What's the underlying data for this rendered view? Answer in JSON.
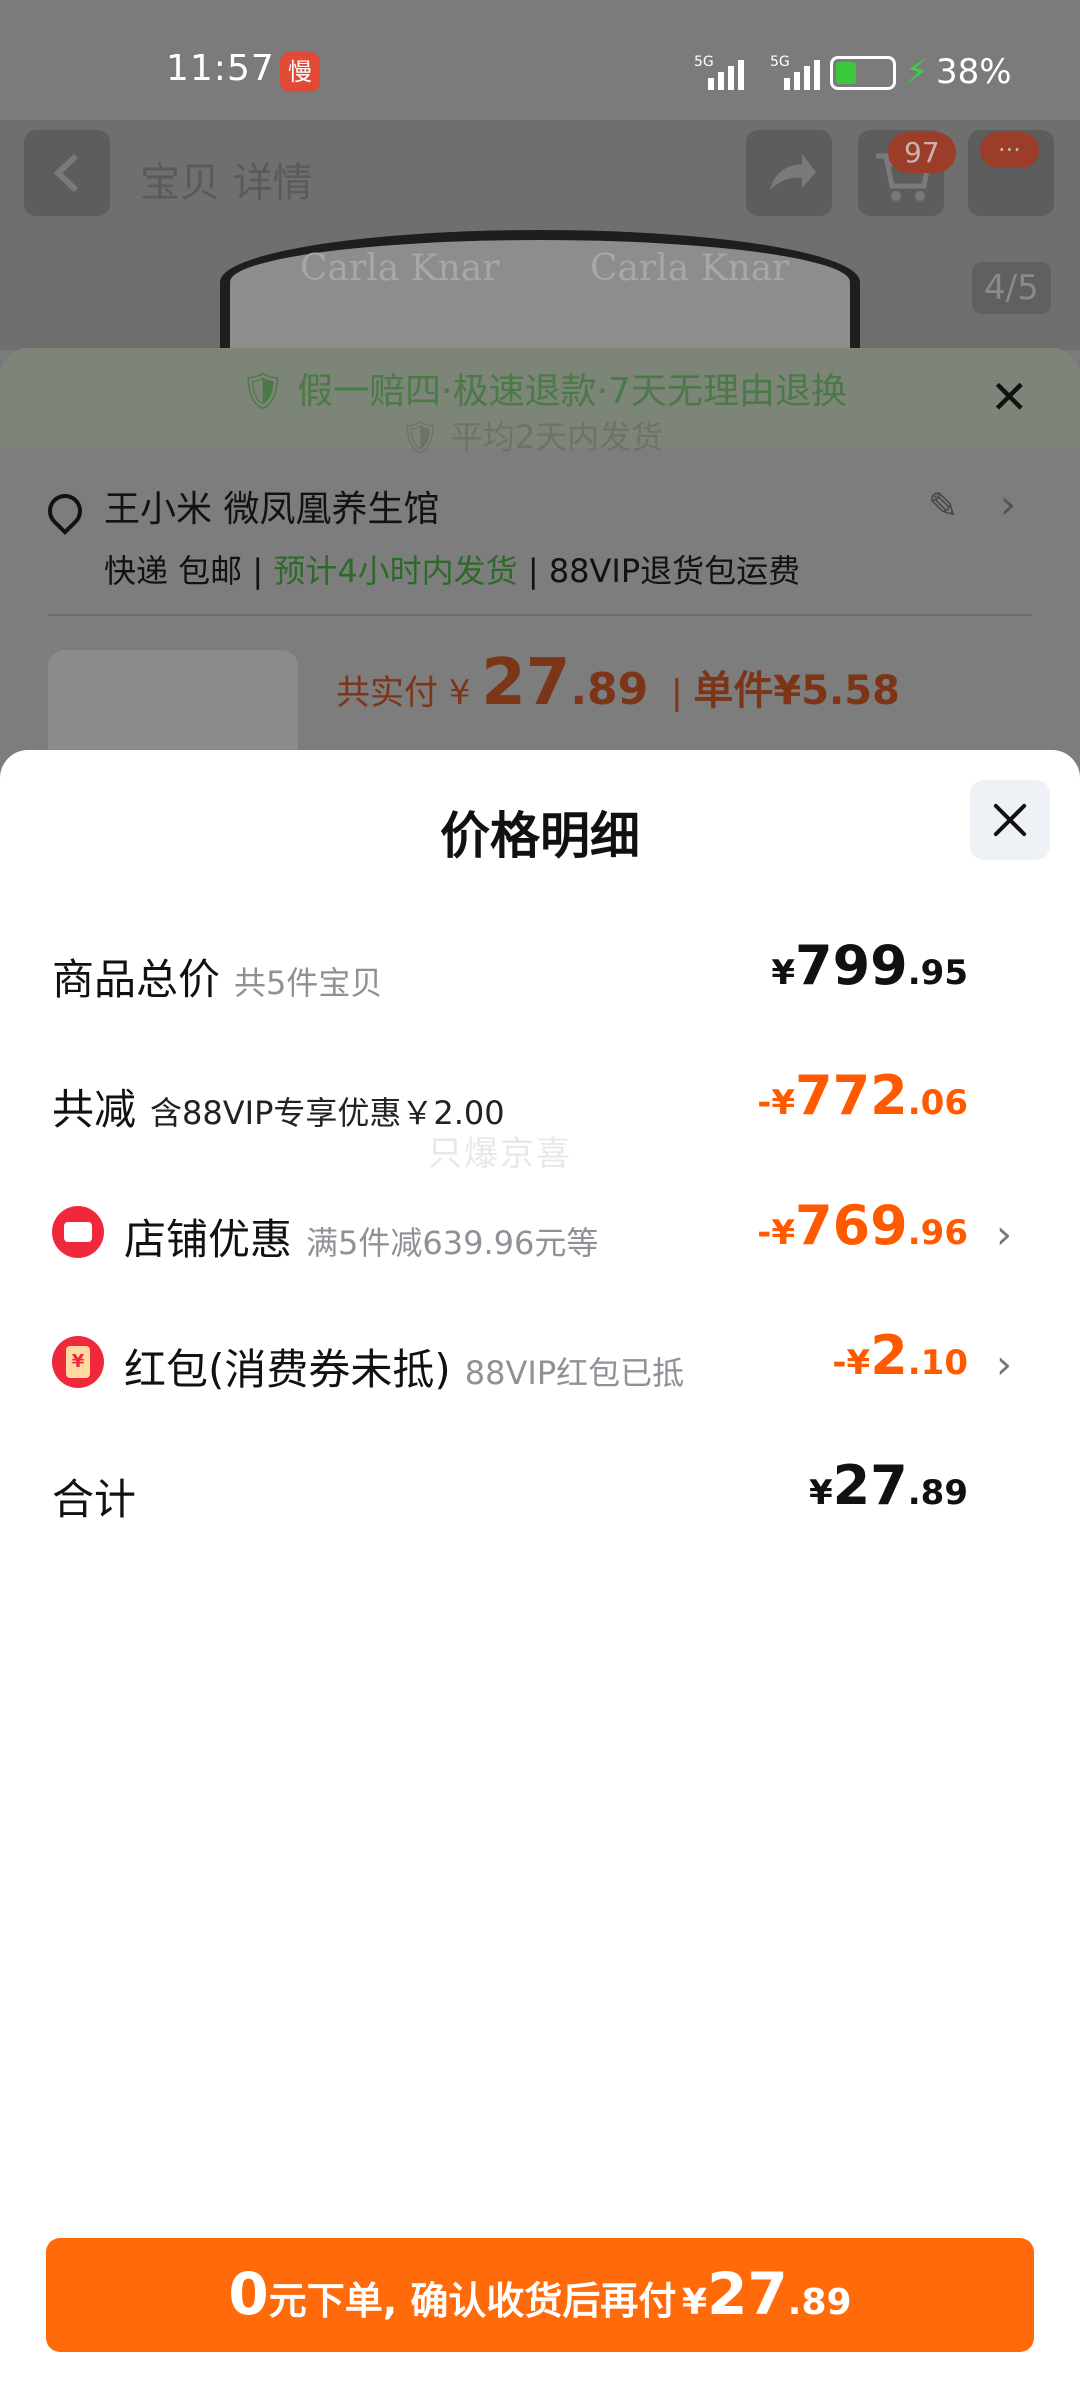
{
  "status_bar": {
    "time": "11:57",
    "app_badge": "慢",
    "signal_1": "5G",
    "signal_2": "5G",
    "battery_percent": "38%"
  },
  "background": {
    "title": "宝贝 详情",
    "cart_badge": "97",
    "more_badge": "···",
    "product_brand": "Carla Knar",
    "image_counter": "4/5",
    "guarantee_line_1": "假一赔四·极速退款·7天无理由退换",
    "guarantee_line_2": "平均2天内发货",
    "address": "王小米 微凤凰养生馆",
    "shipping": "快递 包邮",
    "shipping_eta": "预计4小时内发货",
    "shipping_extra": "88VIP退货包运费",
    "total_label": "共实付",
    "total_currency": "¥",
    "total_int": "27",
    "total_dec": ".89",
    "unit_price": "单件¥5.58"
  },
  "modal": {
    "title": "价格明细",
    "rows": [
      {
        "label": "商品总价",
        "sub": "共5件宝贝",
        "currency": "¥",
        "int": "799",
        "dec": ".95"
      },
      {
        "label": "共减",
        "sub": "含88VIP专享优惠￥2.00",
        "currency": "-¥",
        "int": "772",
        "dec": ".06"
      },
      {
        "label": "店铺优惠",
        "sub": "满5件减639.96元等",
        "currency": "-¥",
        "int": "769",
        "dec": ".96",
        "icon": "store-icon"
      },
      {
        "label": "红包(消费券未抵)",
        "sub": "88VIP红包已抵",
        "currency": "-¥",
        "int": "2",
        "dec": ".10",
        "icon": "red-envelope-icon"
      },
      {
        "label": "合计",
        "sub": "",
        "currency": "¥",
        "int": "27",
        "dec": ".89"
      }
    ],
    "watermark": "只爆京喜"
  },
  "pay_button": {
    "zero": "0",
    "text": "元下单, 确认收货后再付",
    "currency": "¥",
    "int": "27",
    "dec": ".89"
  },
  "colors": {
    "accent": "#ff6a0a",
    "discount": "#ff5a00",
    "icon_red": "#f0283c"
  }
}
